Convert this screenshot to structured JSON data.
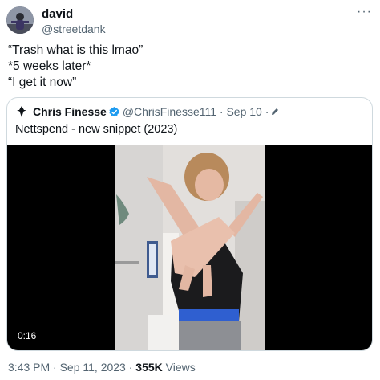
{
  "author": {
    "name": "david",
    "handle": "@streetdank"
  },
  "tweet": {
    "lines": [
      "“Trash what is this lmao”",
      "*5 weeks later*",
      "“I get it now”"
    ]
  },
  "quoted": {
    "name": "Chris Finesse",
    "handle": "@ChrisFinesse111",
    "date": "· Sep 10 ·",
    "text": "Nettspend - new snippet (2023)",
    "video_duration": "0:16"
  },
  "footer": {
    "time": "3:43 PM · Sep 11, 2023 ·",
    "views_count": "355K",
    "views_label": "Views"
  },
  "colors": {
    "verified": "#1d9bf0",
    "secondary_text": "#536471",
    "border": "#cfd9de"
  },
  "icons": [
    "more-icon",
    "verified-icon",
    "edit-icon"
  ]
}
